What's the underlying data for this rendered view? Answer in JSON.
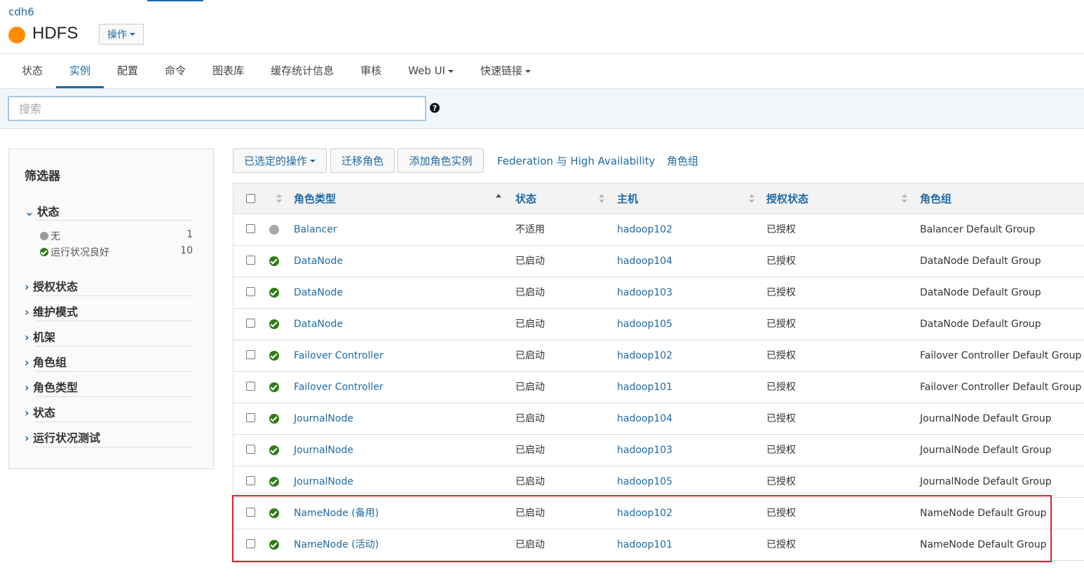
{
  "header": {
    "cluster": "cdh6",
    "service_name": "HDFS",
    "service_status_color": "#ff8a00",
    "actions_label": "操作"
  },
  "tabs": [
    {
      "label": "状态",
      "active": false
    },
    {
      "label": "实例",
      "active": true
    },
    {
      "label": "配置",
      "active": false
    },
    {
      "label": "命令",
      "active": false
    },
    {
      "label": "图表库",
      "active": false
    },
    {
      "label": "缓存统计信息",
      "active": false
    },
    {
      "label": "审核",
      "active": false
    },
    {
      "label": "Web UI",
      "active": false,
      "dropdown": true
    },
    {
      "label": "快速链接",
      "active": false,
      "dropdown": true
    }
  ],
  "search": {
    "placeholder": "搜索",
    "help_icon": "?"
  },
  "filters": {
    "title": "筛选器",
    "expanded_section": {
      "label": "状态",
      "items": [
        {
          "label": "无",
          "count": "1",
          "icon": "gray-dot"
        },
        {
          "label": "运行状况良好",
          "count": "10",
          "icon": "ok-check"
        }
      ]
    },
    "collapsed_sections": [
      "授权状态",
      "维护模式",
      "机架",
      "角色组",
      "角色类型",
      "状态",
      "运行状况测试"
    ]
  },
  "toolbar": {
    "selected_actions": "已选定的操作",
    "migrate_roles": "迁移角色",
    "add_role_instances": "添加角色实例",
    "federation_ha": "Federation 与 High Availability",
    "role_groups": "角色组"
  },
  "table": {
    "headers": {
      "role_type": "角色类型",
      "status": "状态",
      "host": "主机",
      "auth_status": "授权状态",
      "role_group": "角色组"
    },
    "rows": [
      {
        "health": "na",
        "role_type": "Balancer",
        "status": "不适用",
        "host": "hadoop102",
        "auth": "已授权",
        "group": "Balancer Default Group"
      },
      {
        "health": "ok",
        "role_type": "DataNode",
        "status": "已启动",
        "host": "hadoop104",
        "auth": "已授权",
        "group": "DataNode Default Group"
      },
      {
        "health": "ok",
        "role_type": "DataNode",
        "status": "已启动",
        "host": "hadoop103",
        "auth": "已授权",
        "group": "DataNode Default Group"
      },
      {
        "health": "ok",
        "role_type": "DataNode",
        "status": "已启动",
        "host": "hadoop105",
        "auth": "已授权",
        "group": "DataNode Default Group"
      },
      {
        "health": "ok",
        "role_type": "Failover Controller",
        "status": "已启动",
        "host": "hadoop102",
        "auth": "已授权",
        "group": "Failover Controller Default Group"
      },
      {
        "health": "ok",
        "role_type": "Failover Controller",
        "status": "已启动",
        "host": "hadoop101",
        "auth": "已授权",
        "group": "Failover Controller Default Group"
      },
      {
        "health": "ok",
        "role_type": "JournalNode",
        "status": "已启动",
        "host": "hadoop104",
        "auth": "已授权",
        "group": "JournalNode Default Group"
      },
      {
        "health": "ok",
        "role_type": "JournalNode",
        "status": "已启动",
        "host": "hadoop103",
        "auth": "已授权",
        "group": "JournalNode Default Group"
      },
      {
        "health": "ok",
        "role_type": "JournalNode",
        "status": "已启动",
        "host": "hadoop105",
        "auth": "已授权",
        "group": "JournalNode Default Group"
      },
      {
        "health": "ok",
        "role_type": "NameNode (备用)",
        "status": "已启动",
        "host": "hadoop102",
        "auth": "已授权",
        "group": "NameNode Default Group"
      },
      {
        "health": "ok",
        "role_type": "NameNode (活动)",
        "status": "已启动",
        "host": "hadoop101",
        "auth": "已授权",
        "group": "NameNode Default Group"
      }
    ]
  },
  "colors": {
    "link": "#1f6aa5",
    "healthy": "#2e7d16",
    "highlight": "#d9232d"
  }
}
